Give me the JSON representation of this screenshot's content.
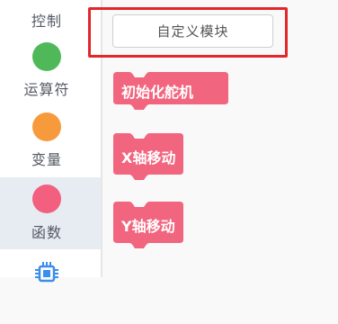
{
  "sidebar": {
    "items": [
      {
        "label": "控制",
        "color": "#f6ab52",
        "active": false
      },
      {
        "label": "运算符",
        "color": "#4fb95a",
        "active": false
      },
      {
        "label": "变量",
        "color": "#f79a3c",
        "active": false
      },
      {
        "label": "函数",
        "color": "#f25f7f",
        "active": true
      },
      {
        "label": "",
        "icon": "chip-icon",
        "color": "#3c8ee8",
        "active": false
      }
    ]
  },
  "palette": {
    "custom_block_button": "自定义模块",
    "blocks": [
      {
        "label": "初始化舵机",
        "color": "#f2657f"
      },
      {
        "label": "X轴移动",
        "color": "#f2657f"
      },
      {
        "label": "Y轴移动",
        "color": "#f2657f"
      }
    ]
  },
  "colors": {
    "highlight": "#e3262a",
    "block": "#f2657f",
    "sidebar_active": "#e7ecf3"
  }
}
